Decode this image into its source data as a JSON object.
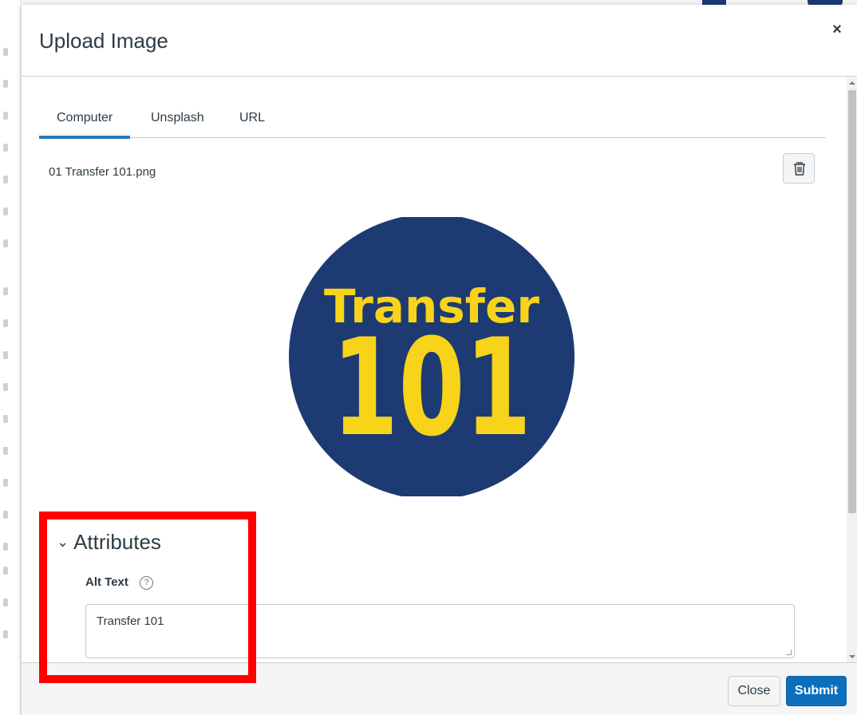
{
  "modal": {
    "title": "Upload Image",
    "close_icon": "×"
  },
  "tabs": [
    {
      "label": "Computer",
      "active": true
    },
    {
      "label": "Unsplash",
      "active": false
    },
    {
      "label": "URL",
      "active": false
    }
  ],
  "file": {
    "name": "01 Transfer 101.png",
    "delete_icon": "trash-icon"
  },
  "preview": {
    "line1": "Transfer",
    "line2": "101",
    "bg_color": "#1d3a72",
    "text_color": "#f7d31a"
  },
  "attributes": {
    "heading": "Attributes",
    "chevron": "⌄",
    "alt_label": "Alt Text",
    "help_icon": "?",
    "alt_value": "Transfer 101"
  },
  "footer": {
    "close_label": "Close",
    "submit_label": "Submit"
  },
  "colors": {
    "accent": "#0b6fbc",
    "tab_underline": "#2b7abc",
    "highlight": "#ff0000"
  }
}
